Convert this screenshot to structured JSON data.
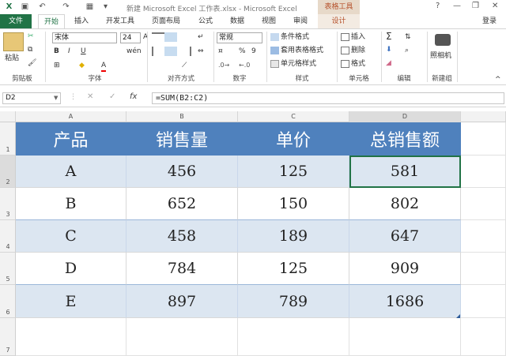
{
  "title_bar": {
    "window_title": "新建 Microsoft Excel 工作表.xlsx - Microsoft Excel",
    "context_tab_group": "表格工具",
    "help": "?",
    "minimize": "—",
    "restore": "❐",
    "close": "✕"
  },
  "tabs": {
    "file": "文件",
    "items": [
      "开始",
      "插入",
      "开发工具",
      "页面布局",
      "公式",
      "数据",
      "视图",
      "审阅",
      "设计"
    ],
    "login": "登录"
  },
  "ribbon": {
    "clipboard": {
      "paste": "粘贴",
      "label": "剪贴板"
    },
    "font": {
      "name": "宋体",
      "size": "24",
      "label": "字体",
      "bold": "B",
      "italic": "I",
      "underline": "U",
      "grow": "A",
      "shrink": "A",
      "font_color": "A",
      "phonetic": "wén"
    },
    "alignment": {
      "label": "对齐方式"
    },
    "number": {
      "format": "常规",
      "percent": "%",
      "comma": "9",
      "label": "数字"
    },
    "styles": {
      "conditional": "条件格式",
      "table": "套用表格格式",
      "cell": "单元格样式",
      "label": "样式"
    },
    "cells": {
      "insert": "插入",
      "delete": "删除",
      "format": "格式",
      "label": "单元格"
    },
    "editing": {
      "label": "编辑"
    },
    "newgroup": {
      "camera": "照相机",
      "label": "新建组"
    }
  },
  "formula_bar": {
    "name_box": "D2",
    "fx": "fx",
    "formula": "=SUM(B2:C2)"
  },
  "sheet": {
    "columns": [
      "A",
      "B",
      "C",
      "D"
    ],
    "rows": [
      "1",
      "2",
      "3",
      "4",
      "5",
      "6",
      "7"
    ],
    "header": [
      "产品",
      "销售量",
      "单价",
      "总销售额"
    ],
    "data": [
      [
        "A",
        "456",
        "125",
        "581"
      ],
      [
        "B",
        "652",
        "150",
        "802"
      ],
      [
        "C",
        "458",
        "189",
        "647"
      ],
      [
        "D",
        "784",
        "125",
        "909"
      ],
      [
        "E",
        "897",
        "789",
        "1686"
      ]
    ]
  },
  "colors": {
    "accent": "#217346",
    "table_header": "#4f81bd",
    "band": "#dce6f1"
  }
}
